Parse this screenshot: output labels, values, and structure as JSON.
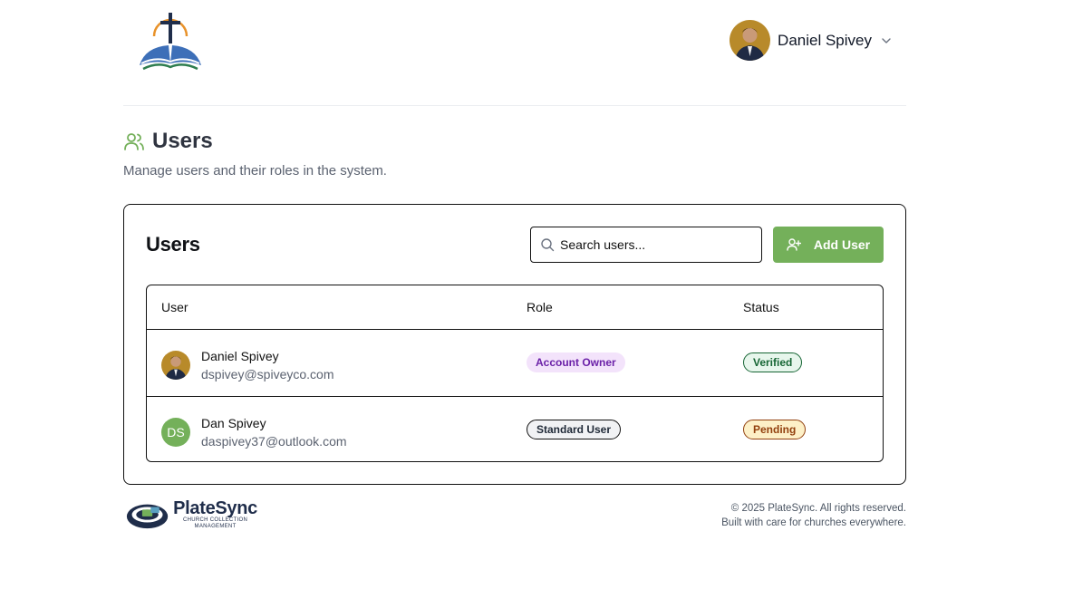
{
  "header": {
    "user_name": "Daniel Spivey"
  },
  "page": {
    "title": "Users",
    "subtitle": "Manage users and their roles in the system."
  },
  "card": {
    "title": "Users",
    "search_placeholder": "Search users...",
    "add_button_label": "Add User"
  },
  "table": {
    "columns": [
      "User",
      "Role",
      "Status"
    ],
    "rows": [
      {
        "name": "Daniel Spivey",
        "email": "dspivey@spiveyco.com",
        "avatar": "photo",
        "role": "Account Owner",
        "status": "Verified"
      },
      {
        "name": "Dan Spivey",
        "email": "daspivey37@outlook.com",
        "initials": "DS",
        "role": "Standard User",
        "status": "Pending"
      }
    ]
  },
  "footer": {
    "brand_name": "PlateSync",
    "brand_tagline_1": "CHURCH COLLECTION",
    "brand_tagline_2": "MANAGEMENT",
    "copyright": "© 2025 PlateSync. All rights reserved.",
    "tagline": "Built with care for churches everywhere."
  },
  "colors": {
    "accent_green": "#74b05a",
    "owner_badge": "#f3e3fb",
    "verified_badge": "#e7f6ec",
    "pending_badge": "#fdf0c7"
  },
  "icons": [
    "church-logo-icon",
    "chevron-down-icon",
    "users-icon",
    "search-icon",
    "user-plus-icon",
    "platesync-logo"
  ]
}
